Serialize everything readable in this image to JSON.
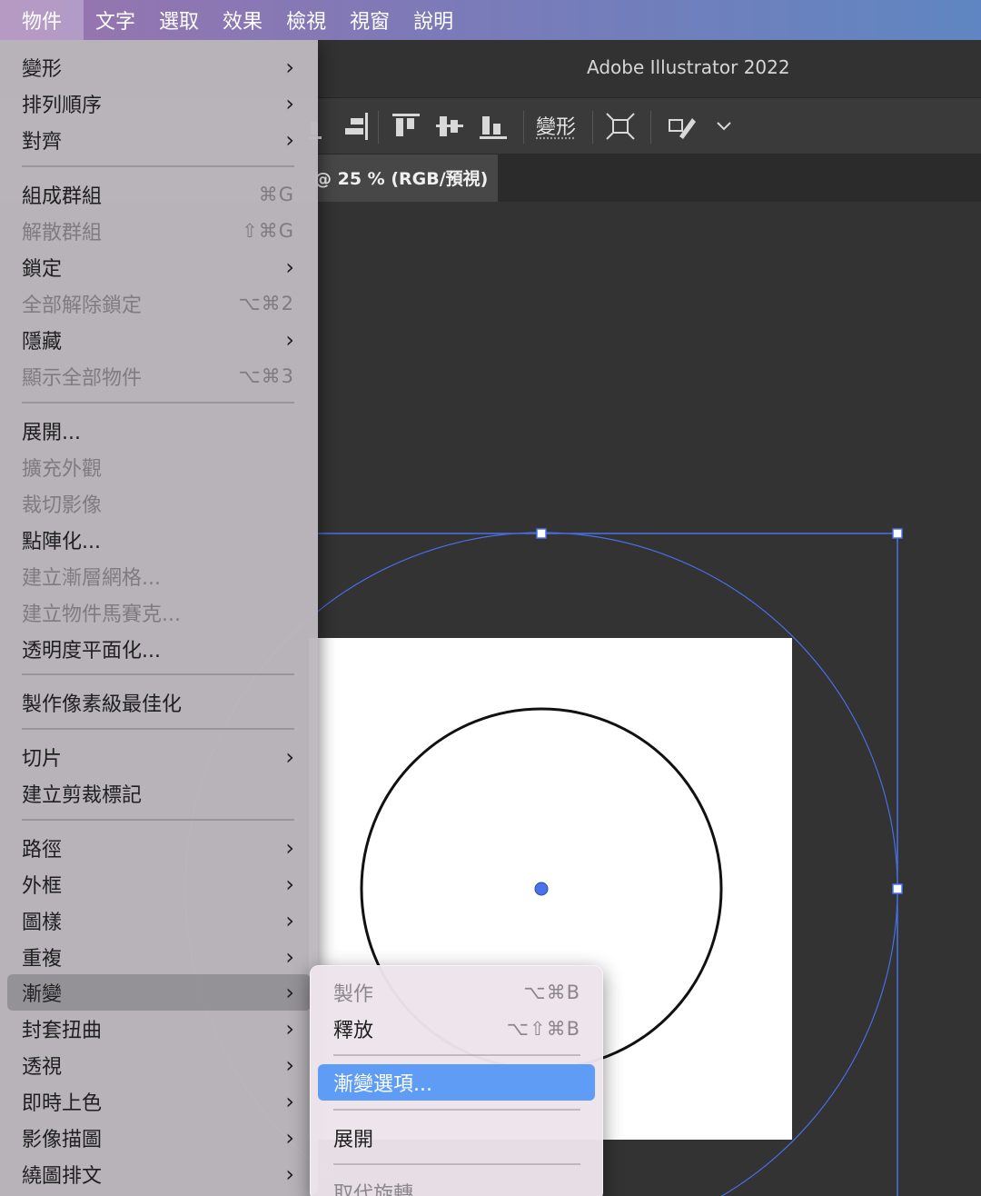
{
  "menubar": {
    "items": [
      "物件",
      "文字",
      "選取",
      "效果",
      "檢視",
      "視窗",
      "說明"
    ]
  },
  "window": {
    "title": "Adobe Illustrator 2022",
    "control_bar": {
      "transform_label": "變形"
    },
    "document_tab": {
      "label": "@ 25 % (RGB/預視)"
    }
  },
  "object_menu": {
    "items": [
      {
        "label": "變形",
        "submenu": true
      },
      {
        "label": "排列順序",
        "submenu": true
      },
      {
        "label": "對齊",
        "submenu": true
      },
      {
        "label": "組成群組",
        "shortcut": "⌘G"
      },
      {
        "label": "解散群組",
        "shortcut": "⇧⌘G",
        "disabled": true
      },
      {
        "label": "鎖定",
        "submenu": true
      },
      {
        "label": "全部解除鎖定",
        "shortcut": "⌥⌘2",
        "disabled": true
      },
      {
        "label": "隱藏",
        "submenu": true
      },
      {
        "label": "顯示全部物件",
        "shortcut": "⌥⌘3",
        "disabled": true
      },
      {
        "label": "展開..."
      },
      {
        "label": "擴充外觀",
        "disabled": true
      },
      {
        "label": "裁切影像",
        "disabled": true
      },
      {
        "label": "點陣化..."
      },
      {
        "label": "建立漸層網格...",
        "disabled": true
      },
      {
        "label": "建立物件馬賽克...",
        "disabled": true
      },
      {
        "label": "透明度平面化..."
      },
      {
        "label": "製作像素級最佳化"
      },
      {
        "label": "切片",
        "submenu": true
      },
      {
        "label": "建立剪裁標記"
      },
      {
        "label": "路徑",
        "submenu": true
      },
      {
        "label": "外框",
        "submenu": true
      },
      {
        "label": "圖樣",
        "submenu": true
      },
      {
        "label": "重複",
        "submenu": true
      },
      {
        "label": "漸變",
        "submenu": true,
        "highlighted": true
      },
      {
        "label": "封套扭曲",
        "submenu": true
      },
      {
        "label": "透視",
        "submenu": true
      },
      {
        "label": "即時上色",
        "submenu": true
      },
      {
        "label": "影像描圖",
        "submenu": true
      },
      {
        "label": "繞圖排文",
        "submenu": true
      }
    ]
  },
  "blend_submenu": {
    "items": [
      {
        "label": "製作",
        "shortcut": "⌥⌘B",
        "disabled": true
      },
      {
        "label": "釋放",
        "shortcut": "⌥⇧⌘B"
      },
      {
        "label": "漸變選項...",
        "selected": true
      },
      {
        "label": "展開"
      },
      {
        "label": "取代旋轉",
        "disabled": true
      }
    ]
  },
  "icons": {
    "submenu_arrow": "›",
    "ctrl": [
      "align-bottom-partial-icon",
      "align-right-icon",
      "align-top-icon",
      "align-vertical-center-icon",
      "align-bottom-icon",
      "transform-icon",
      "pen-warp-icon",
      "chevron-down-icon"
    ]
  },
  "colors": {
    "selection_blue": "#4a72e8",
    "menu_highlight": "#5e9cf5"
  }
}
